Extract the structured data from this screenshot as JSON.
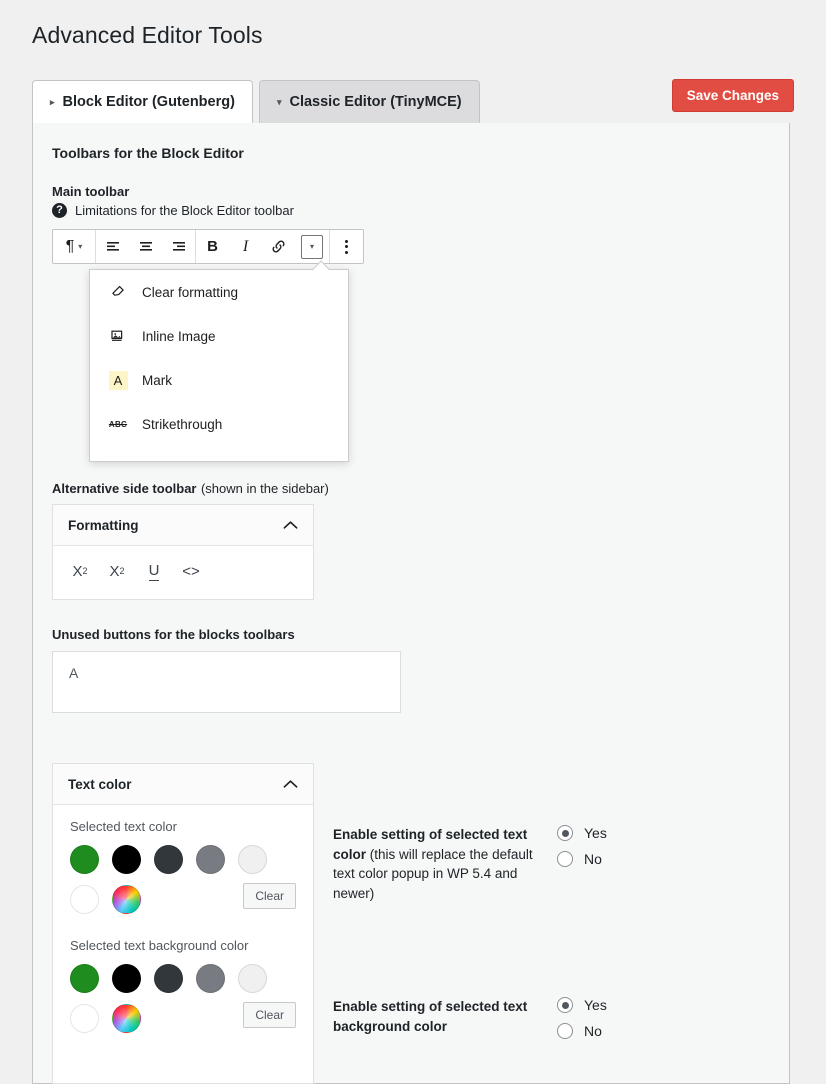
{
  "header": {
    "title": "Advanced Editor Tools"
  },
  "tabs": [
    {
      "label": "Block Editor (Gutenberg)",
      "marker": "▸",
      "active": true
    },
    {
      "label": "Classic Editor (TinyMCE)",
      "marker": "▾",
      "active": false
    }
  ],
  "save_button": {
    "label": "Save Changes",
    "color": "#e14d43"
  },
  "sections": {
    "toolbars_heading": "Toolbars for the Block Editor",
    "main_toolbar_label": "Main toolbar",
    "limitations_link": "Limitations for the Block Editor toolbar",
    "help_icon_glyph": "?",
    "alt_toolbar_label_bold": "Alternative side toolbar",
    "alt_toolbar_label_rest": "(shown in the sidebar)",
    "unused_buttons_label": "Unused buttons for the blocks toolbars",
    "unused_buttons_item": "A"
  },
  "editor_toolbar": {
    "buttons": [
      {
        "name": "paragraph-block-type",
        "glyph": "¶",
        "caret": "▾"
      },
      {
        "name": "align-left",
        "glyph": "≡"
      },
      {
        "name": "align-center",
        "glyph": "≡"
      },
      {
        "name": "align-right",
        "glyph": "≡"
      },
      {
        "name": "bold",
        "glyph": "B"
      },
      {
        "name": "italic",
        "glyph": "I"
      },
      {
        "name": "link",
        "glyph": "🔗"
      },
      {
        "name": "more-formatting-caret",
        "glyph": "▾"
      },
      {
        "name": "options-vertical-dots",
        "glyph": "⋮"
      }
    ]
  },
  "dropdown": {
    "items": [
      {
        "label": "Clear formatting",
        "icon": "eraser-icon",
        "glyph": "⊘"
      },
      {
        "label": "Inline Image",
        "icon": "inline-image-icon",
        "glyph": "⌽"
      },
      {
        "label": "Mark",
        "icon": "mark-icon",
        "glyph": "A",
        "highlight": "#fdf4c8"
      },
      {
        "label": "Strikethrough",
        "icon": "strikethrough-icon",
        "glyph": "ABC"
      }
    ]
  },
  "formatting_panel": {
    "title": "Formatting",
    "collapse_glyph": "⌃",
    "buttons": [
      {
        "name": "superscript",
        "base": "X",
        "script": "2",
        "type": "sup"
      },
      {
        "name": "subscript",
        "base": "X",
        "script": "2",
        "type": "sub"
      },
      {
        "name": "underline",
        "glyph": "U"
      },
      {
        "name": "code",
        "glyph": "<>"
      }
    ]
  },
  "text_color_panel": {
    "title": "Text color",
    "collapse_glyph": "⌃",
    "groups": [
      {
        "label": "Selected text color",
        "clear_label": "Clear",
        "row1": [
          "#1e8c1e",
          "#000000",
          "#32373c",
          "#787c82",
          "#f0f0f1"
        ],
        "row2": [
          "#ffffff",
          "rainbow"
        ]
      },
      {
        "label": "Selected text background color",
        "clear_label": "Clear",
        "row1": [
          "#1e8c1e",
          "#000000",
          "#32373c",
          "#787c82",
          "#f0f0f1"
        ],
        "row2": [
          "#ffffff",
          "rainbow"
        ]
      }
    ]
  },
  "settings": [
    {
      "bold_text": "Enable setting of selected text color",
      "rest_text": " (this will replace the default text color popup in WP 5.4 and newer)",
      "options": [
        {
          "label": "Yes",
          "checked": true
        },
        {
          "label": "No",
          "checked": false
        }
      ]
    },
    {
      "bold_text": "Enable setting of selected text background color",
      "rest_text": "",
      "options": [
        {
          "label": "Yes",
          "checked": true
        },
        {
          "label": "No",
          "checked": false
        }
      ]
    }
  ]
}
